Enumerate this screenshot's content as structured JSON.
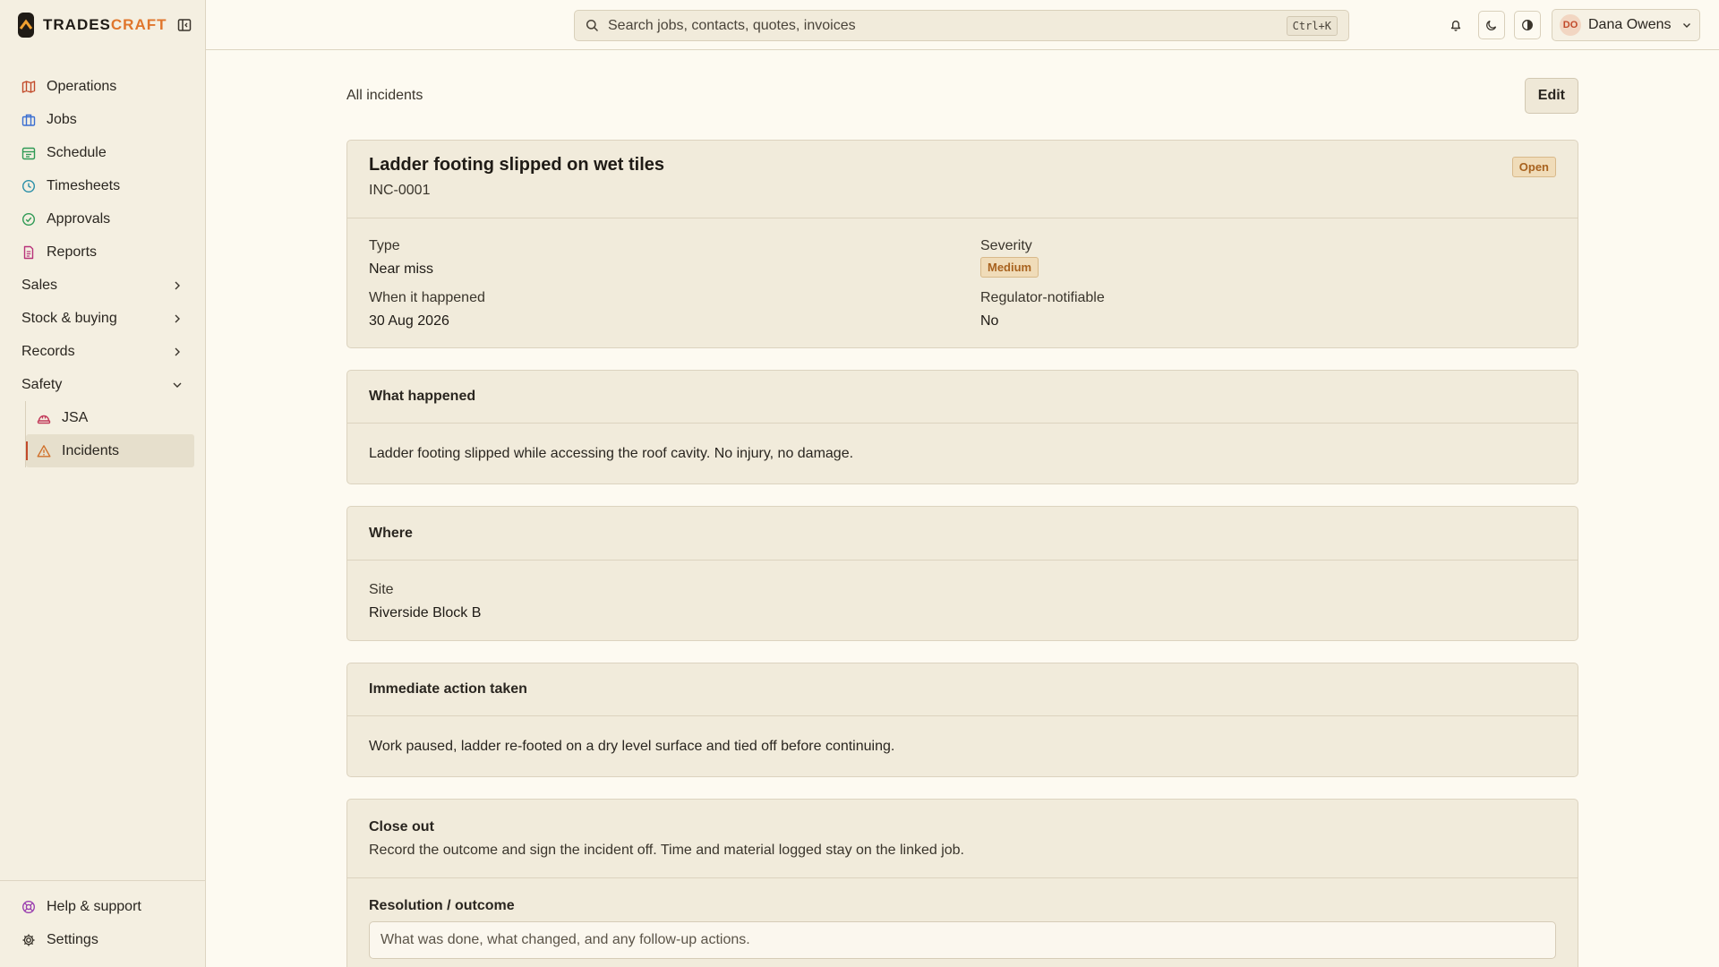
{
  "app": {
    "brand_left": "TRADES",
    "brand_right": "CRAFT"
  },
  "topbar": {
    "search_placeholder": "Search jobs, contacts, quotes, invoices",
    "search_shortcut": "Ctrl+K",
    "user_initials": "DO",
    "user_name": "Dana Owens"
  },
  "sidebar": {
    "items": [
      {
        "label": "Operations",
        "icon": "map-icon",
        "color": "#c24a2a"
      },
      {
        "label": "Jobs",
        "icon": "briefcase-icon",
        "color": "#3b6fd1"
      },
      {
        "label": "Schedule",
        "icon": "calendar-icon",
        "color": "#2f9a55"
      },
      {
        "label": "Timesheets",
        "icon": "clock-icon",
        "color": "#2a8fa8"
      },
      {
        "label": "Approvals",
        "icon": "check-circle-icon",
        "color": "#2f9a55"
      },
      {
        "label": "Reports",
        "icon": "document-icon",
        "color": "#b8327a"
      }
    ],
    "groups": [
      {
        "label": "Sales"
      },
      {
        "label": "Stock & buying"
      },
      {
        "label": "Records"
      },
      {
        "label": "Safety"
      }
    ],
    "safety_items": [
      {
        "label": "JSA",
        "icon": "hard-hat-icon",
        "color": "#c23a5a"
      },
      {
        "label": "Incidents",
        "icon": "warning-triangle-icon",
        "color": "#d0702a"
      }
    ],
    "bottom": [
      {
        "label": "Help & support",
        "icon": "lifebuoy-icon",
        "color": "#9a3fb0"
      },
      {
        "label": "Settings",
        "icon": "gear-icon",
        "color": "#3a352c"
      }
    ]
  },
  "page": {
    "breadcrumb": "All incidents",
    "edit_label": "Edit",
    "title": "Ladder footing slipped on wet tiles",
    "id": "INC-0001",
    "status": "Open",
    "type_label": "Type",
    "type_value": "Near miss",
    "severity_label": "Severity",
    "severity_value": "Medium",
    "when_label": "When it happened",
    "when_value": "30 Aug 2026",
    "notifiable_label": "Regulator-notifiable",
    "notifiable_value": "No",
    "what_title": "What happened",
    "what_text": "Ladder footing slipped while accessing the roof cavity. No injury, no damage.",
    "where_title": "Where",
    "site_label": "Site",
    "site_value": "Riverside Block B",
    "action_title": "Immediate action taken",
    "action_text": "Work paused, ladder re-footed on a dry level surface and tied off before continuing.",
    "close_title": "Close out",
    "close_desc": "Record the outcome and sign the incident off. Time and material logged stay on the linked job.",
    "resolution_label": "Resolution / outcome",
    "resolution_placeholder": "What was done, what changed, and any follow-up actions."
  }
}
